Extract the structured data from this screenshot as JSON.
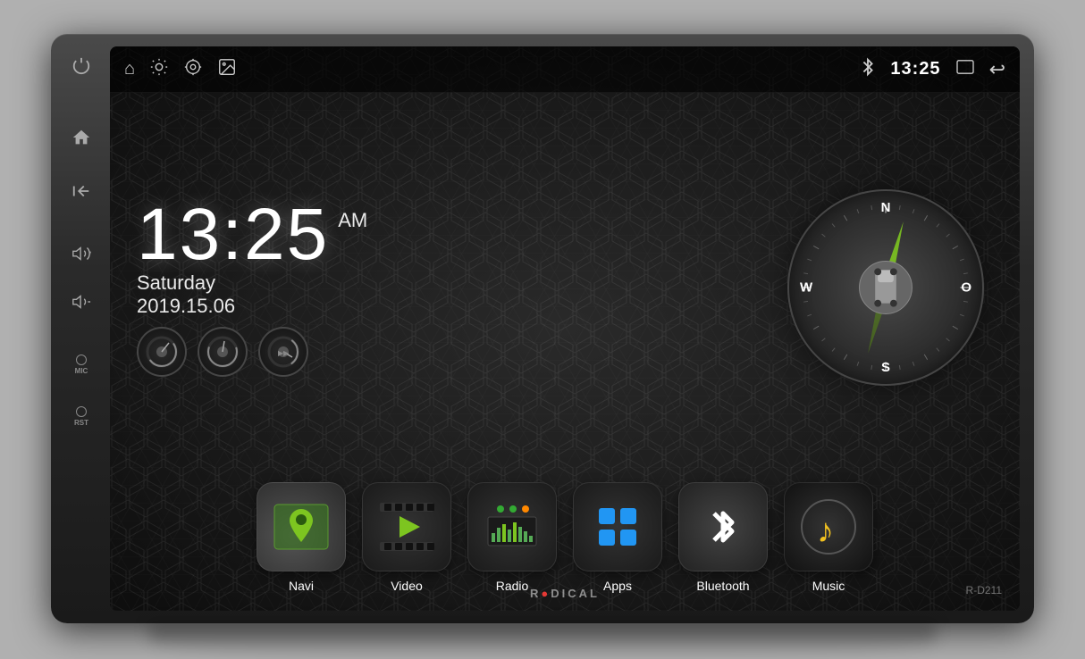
{
  "device": {
    "brand": "RADICAL",
    "model": "R-D211"
  },
  "statusBar": {
    "time": "13:25",
    "icons": {
      "home": "⌂",
      "brightness": "☀",
      "location": "⊕",
      "image": "▣",
      "bluetooth": "bluetooth",
      "window": "▭",
      "back": "↩"
    }
  },
  "clock": {
    "time": "13:25",
    "ampm": "AM",
    "day": "Saturday",
    "date": "2019.15.06"
  },
  "compass": {
    "north": "N",
    "south": "S",
    "east": "O",
    "west": "W"
  },
  "apps": [
    {
      "id": "navi",
      "label": "Navi",
      "color": "#7dc520"
    },
    {
      "id": "video",
      "label": "Video",
      "color": "#7dc520"
    },
    {
      "id": "radio",
      "label": "Radio",
      "color": "#aaaaaa"
    },
    {
      "id": "apps",
      "label": "Apps",
      "color": "#2196f3"
    },
    {
      "id": "bluetooth",
      "label": "Bluetooth",
      "color": "#ffffff"
    },
    {
      "id": "music",
      "label": "Music",
      "color": "#f0c020"
    }
  ],
  "sideButtons": {
    "power": "⏻",
    "home": "⌂",
    "back": "↩",
    "volUp": "♪+",
    "volDown": "♪-",
    "mic": "MIC",
    "rst": "RST"
  }
}
